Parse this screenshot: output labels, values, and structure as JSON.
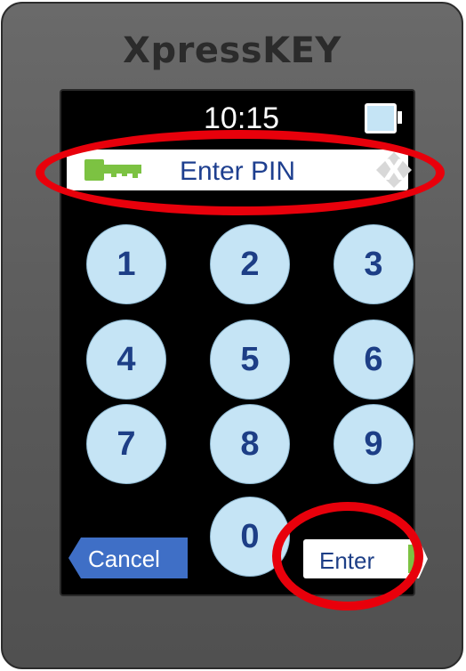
{
  "device": {
    "brand": "XpressKEY"
  },
  "status": {
    "time": "10:15",
    "battery_icon": "battery-icon",
    "battery_color": "#c5e4f5"
  },
  "pin_bar": {
    "label": "Enter PIN",
    "key_icon": "key-icon",
    "key_icon_color": "#7cc242",
    "clear_label": "X"
  },
  "keypad": {
    "keys": [
      "1",
      "2",
      "3",
      "4",
      "5",
      "6",
      "7",
      "8",
      "9",
      "0"
    ],
    "key_color": "#c5e4f5",
    "digit_color": "#1d3e86"
  },
  "actions": {
    "cancel_label": "Cancel",
    "cancel_color": "#3f6fc6",
    "enter_label": "Enter",
    "enter_arrow_color": "#7cc242"
  },
  "annotations": {
    "highlight_color": "#e8000b"
  }
}
